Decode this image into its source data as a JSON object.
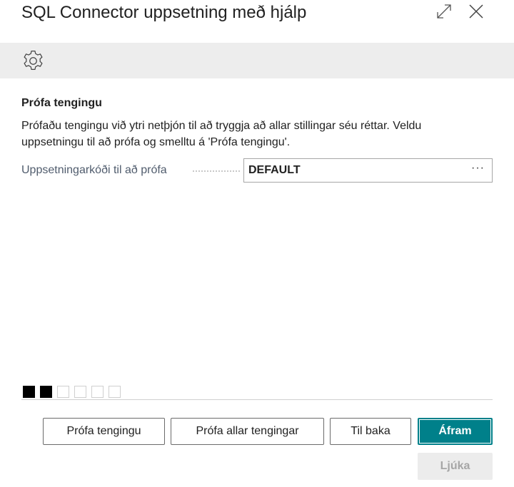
{
  "window": {
    "title": "SQL Connector uppsetning með hjálp",
    "expand_icon": "expand-icon",
    "close_icon": "close-icon"
  },
  "toolbar": {
    "settings_icon": "gear-icon"
  },
  "section": {
    "title": "Prófa tengingu",
    "instructions": "Prófaðu tengingu við ytri netþjón til að tryggja að allar stillingar séu réttar. Veldu uppsetningu til að prófa og smelltu á 'Prófa tengingu'."
  },
  "field": {
    "label": "Uppsetningarkóði til að prófa",
    "value": "DEFAULT",
    "lookup": "···"
  },
  "steps": {
    "total": 6,
    "completed": 2
  },
  "buttons": {
    "test_connection": "Prófa tengingu",
    "test_all_connections": "Prófa allar tengingar",
    "back": "Til baka",
    "next": "Áfram",
    "finish": "Ljúka"
  },
  "colors": {
    "primary": "#00808a",
    "toolbar_bg": "#ededed",
    "disabled_bg": "#ececec",
    "disabled_text": "#a6a6a6"
  }
}
